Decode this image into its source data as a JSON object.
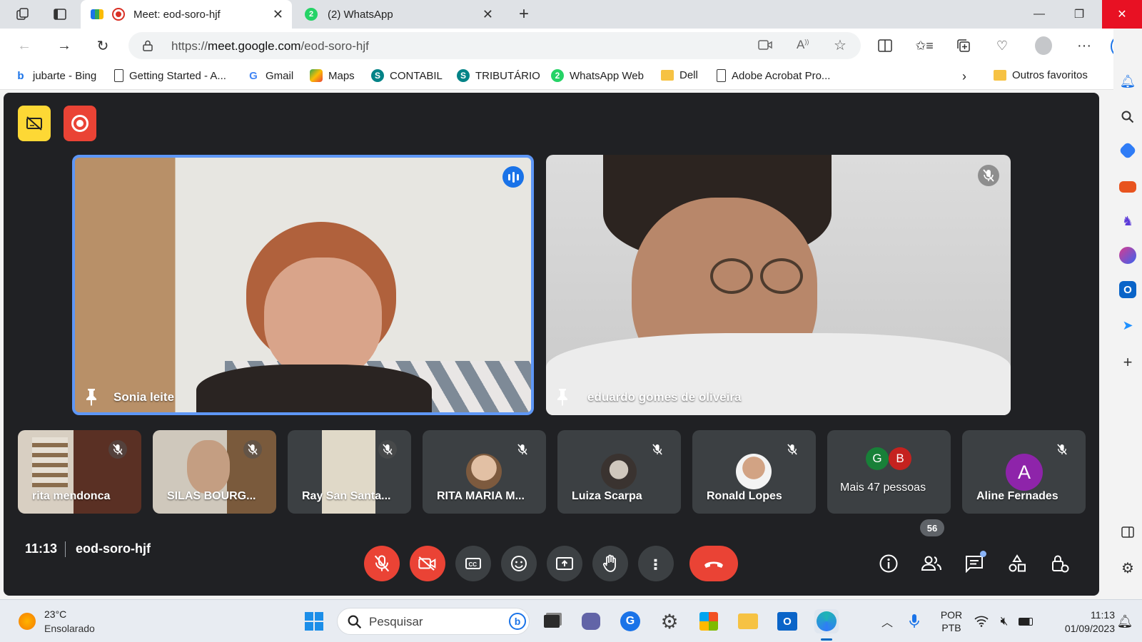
{
  "browser": {
    "tabs": [
      {
        "title": "Meet: eod-soro-hjf",
        "active": true
      },
      {
        "title": "(2) WhatsApp",
        "active": false
      }
    ],
    "url_prefix": "https://",
    "url_host": "meet.google.com",
    "url_path": "/eod-soro-hjf",
    "bookmarks": [
      "jubarte - Bing",
      "Getting Started - A...",
      "Gmail",
      "Maps",
      "CONTABIL",
      "TRIBUTÁRIO",
      "WhatsApp Web",
      "Dell",
      "Adobe Acrobat Pro..."
    ],
    "other_favorites": "Outros favoritos"
  },
  "meet": {
    "main_tiles": [
      {
        "name": "Sonia leite",
        "speaking": true
      },
      {
        "name": "eduardo gomes de oliveira",
        "speaking": false
      }
    ],
    "small_tiles": [
      {
        "name": "rita mendonca"
      },
      {
        "name": "SILAS BOURG..."
      },
      {
        "name": "Ray San Santa..."
      },
      {
        "name": "RITA MARIA M..."
      },
      {
        "name": "Luiza Scarpa"
      },
      {
        "name": "Ronald Lopes"
      },
      {
        "name": "Mais 47 pessoas",
        "avatars": [
          "G",
          "B"
        ]
      },
      {
        "name": "Aline Fernades",
        "avatar": "A"
      }
    ],
    "time": "11:13",
    "meeting_code": "eod-soro-hjf",
    "participants_count": "56"
  },
  "taskbar": {
    "weather_temp": "23°C",
    "weather_desc": "Ensolarado",
    "search_placeholder": "Pesquisar",
    "lang_line1": "POR",
    "lang_line2": "PTB",
    "clock_time": "11:13",
    "clock_date": "01/09/2023"
  },
  "colors": {
    "meet_bg": "#202124",
    "active_speaker": "#5e97f6",
    "red": "#ea4335",
    "control_grey": "#3c4043"
  }
}
